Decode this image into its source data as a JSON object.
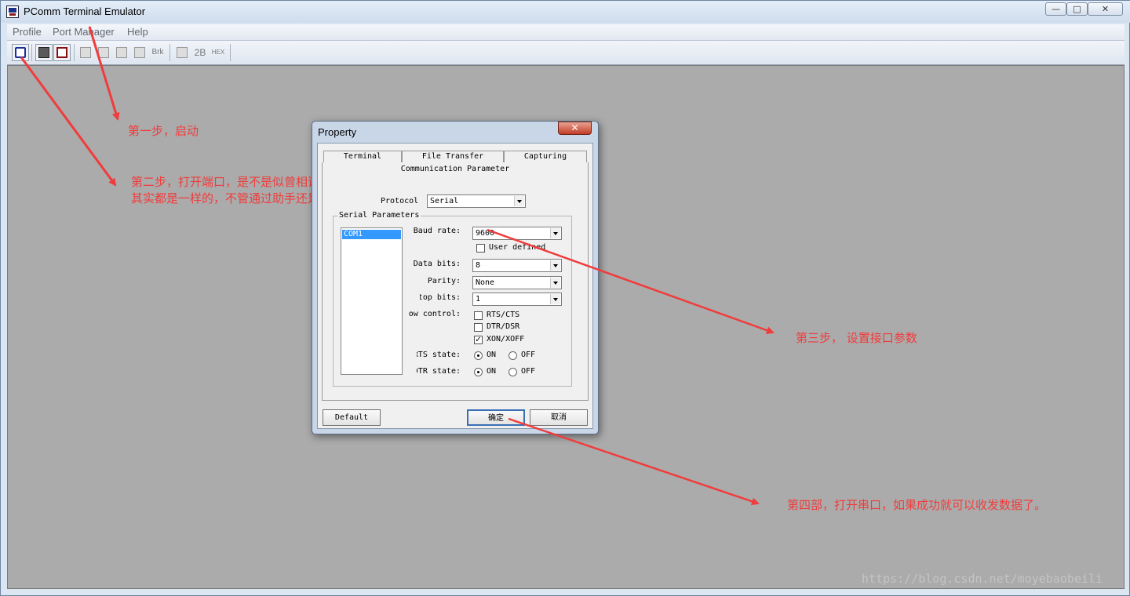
{
  "window": {
    "title": "PComm Terminal Emulator",
    "controls": {
      "minimize": "—",
      "maximize": "□",
      "close": "✕"
    }
  },
  "menu": {
    "items": [
      "Profile",
      "Port Manager",
      "Help"
    ]
  },
  "toolbar": {
    "buttons": [
      {
        "icon": "open-port-icon",
        "label": ""
      },
      {
        "icon": "save-icon",
        "label": ""
      },
      {
        "icon": "exit-icon",
        "label": ""
      },
      {
        "icon": "property-icon",
        "label": ""
      },
      {
        "icon": "transfer-icon",
        "label": ""
      },
      {
        "icon": "capture-icon",
        "label": ""
      },
      {
        "icon": "hangup-icon",
        "label": ""
      },
      {
        "icon": "break-icon",
        "label": "Brk"
      },
      {
        "icon": "dial-icon",
        "label": ""
      },
      {
        "icon": "2b-icon",
        "label": "2B"
      },
      {
        "icon": "hex-icon",
        "label": "HEX"
      }
    ]
  },
  "annotations": {
    "step1": "第一步，启动",
    "step2_line1": "第二步，打开端口，是不是似曾相识",
    "step2_line2": "其实都是一样的，不管通过助手还是API",
    "step3": "第三步， 设置接口参数",
    "step4": "第四部，打开串口，如果成功就可以收发数据了。"
  },
  "watermark": "https://blog.csdn.net/moyebaobeili",
  "dialog": {
    "title": "Property",
    "close": "✕",
    "tabs": [
      "Terminal",
      "File Transfer",
      "Capturing"
    ],
    "section_title": "Communication Parameter",
    "protocol_label": "Protocol",
    "protocol_value": "Serial",
    "group_title": "Serial Parameters",
    "ports": [
      "COM1"
    ],
    "baud_label": "Baud rate:",
    "baud_value": "9600",
    "user_defined_label": "User defined",
    "data_bits_label": "Data bits:",
    "data_bits_value": "8",
    "parity_label": "Parity:",
    "parity_value": "None",
    "stop_bits_label": "Stop bits:",
    "stop_bits_value": "1",
    "flow_label": "Flow control:",
    "flow": [
      "RTS/CTS",
      "DTR/DSR",
      "XON/XOFF"
    ],
    "flow_checked": [
      false,
      false,
      true
    ],
    "rts_label": "RTS state:",
    "dtr_label": "DTR state:",
    "on": "ON",
    "off": "OFF",
    "default_button": "Default",
    "ok_button": "确定",
    "cancel_button": "取消"
  },
  "colors": {
    "annotation": "#f03c3c",
    "workspace": "#ababab",
    "selection": "#3399ff"
  }
}
